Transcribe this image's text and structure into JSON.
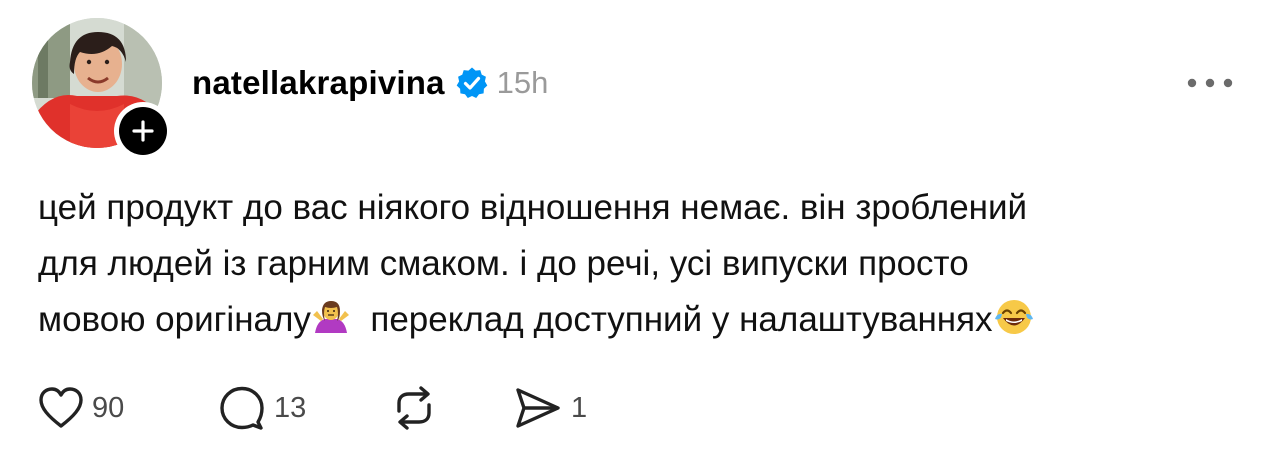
{
  "author": {
    "username": "natellakrapivina",
    "verified_icon": "verified-badge-icon",
    "timestamp": "15h",
    "follow_icon": "plus-icon"
  },
  "post": {
    "line1": "цей продукт до вас ніякого відношення немає. він зроблений",
    "line2": "для людей із гарним смаком. і до речі, усі випуски просто",
    "line3a": "мовою оригіналу",
    "line3b": "  переклад доступний у налаштуваннях",
    "emoji1": "woman-shrugging-emoji",
    "emoji2": "face-with-tears-of-joy-emoji"
  },
  "actions": {
    "like_count": "90",
    "reply_count": "13",
    "repost_count": "",
    "share_count": "1"
  },
  "colors": {
    "verified_blue": "#0095f6",
    "muted_text": "#9a9a9a",
    "icon_stroke": "#222222"
  }
}
